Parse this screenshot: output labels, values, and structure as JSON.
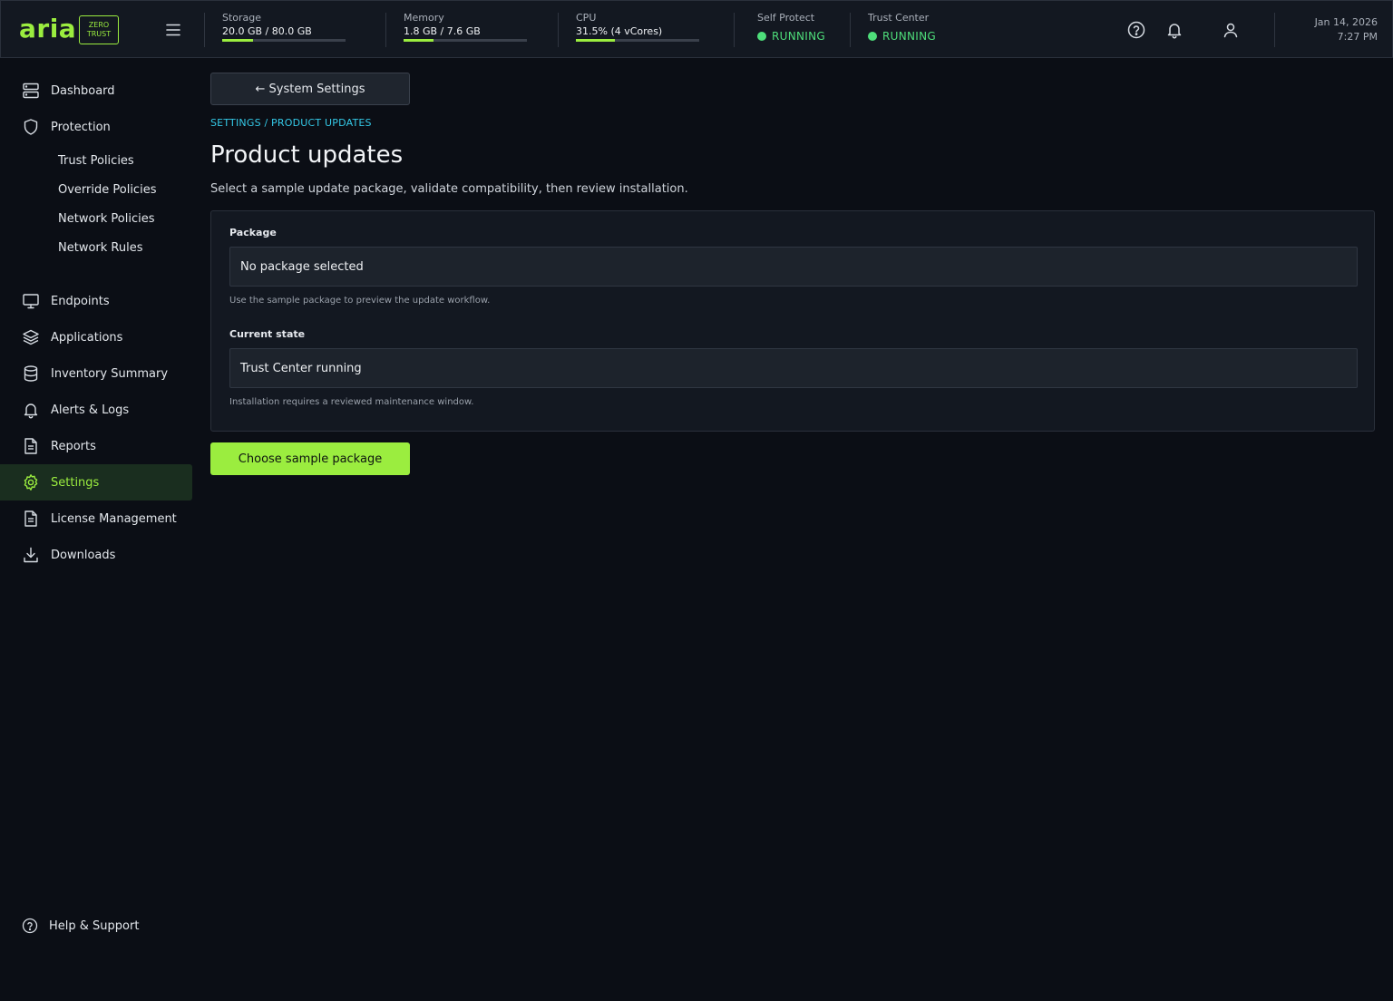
{
  "brand": {
    "name": "aria",
    "badge_line1": "ZERO",
    "badge_line2": "TRUST",
    "accent": "#9bed3f"
  },
  "topbar": {
    "metrics": [
      {
        "label": "Storage",
        "value": "20.0 GB / 80.0 GB",
        "fraction": 0.25
      },
      {
        "label": "Memory",
        "value": "1.8 GB / 7.6 GB",
        "fraction": 0.24
      },
      {
        "label": "CPU",
        "value": "31.5% (4 vCores)",
        "fraction": 0.315
      }
    ],
    "statuses": [
      {
        "label": "Self Protect",
        "value": "RUNNING",
        "color": "#4ede7a"
      },
      {
        "label": "Trust Center",
        "value": "RUNNING",
        "color": "#4ede7a"
      }
    ],
    "icons": [
      "menu-icon",
      "help-icon",
      "bell-icon",
      "user-icon"
    ],
    "date": "Jan 14, 2026",
    "time": "7:27 PM"
  },
  "sidebar": {
    "items": [
      {
        "label": "Dashboard",
        "icon": "server-icon"
      },
      {
        "label": "Protection",
        "icon": "shield-icon"
      },
      {
        "label": "Endpoints",
        "icon": "monitor-icon"
      },
      {
        "label": "Applications",
        "icon": "layers-icon"
      },
      {
        "label": "Inventory Summary",
        "icon": "database-icon"
      },
      {
        "label": "Alerts & Logs",
        "icon": "bell-icon"
      },
      {
        "label": "Reports",
        "icon": "document-icon"
      },
      {
        "label": "Settings",
        "icon": "gear-icon",
        "active": true
      },
      {
        "label": "License Management",
        "icon": "document-icon"
      },
      {
        "label": "Downloads",
        "icon": "download-icon"
      }
    ],
    "protection_children": [
      "Trust Policies",
      "Override Policies",
      "Network Policies",
      "Network Rules"
    ],
    "help": {
      "label": "Help & Support",
      "icon": "help-circle-icon"
    }
  },
  "main": {
    "back_label": "← System Settings",
    "breadcrumb": "SETTINGS / PRODUCT UPDATES",
    "title": "Product updates",
    "description": "Select a sample update package, validate compatibility, then review installation.",
    "fields": [
      {
        "label": "Package",
        "value": "No package selected",
        "help": "Use the sample package to preview the update workflow."
      },
      {
        "label": "Current state",
        "value": "Trust Center running",
        "help": "Installation requires a reviewed maintenance window."
      }
    ],
    "primary_label": "Choose sample package"
  }
}
